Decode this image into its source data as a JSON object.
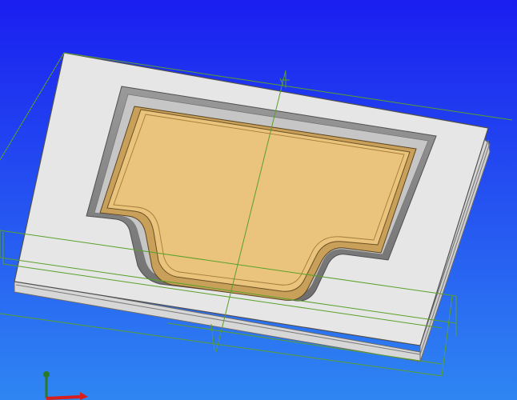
{
  "viewport": {
    "background_top": "#1a1ef0",
    "background_bottom": "#2f86f2"
  },
  "model": {
    "plate_color": "#e6e6e6",
    "plate_edge_color": "#bfbfbf",
    "cavity_wall_color": "#8c8c8c",
    "part_color": "#eac47c",
    "part_rim_color": "#c9a05a",
    "outline_color": "#505050",
    "construction_line_color": "#5aa02a"
  },
  "triad": {
    "icon": "coordinate-triad-icon",
    "x_axis_color": "#d81e1e",
    "y_axis_color": "#2ca02c",
    "z_axis_color": "#2a7a2a"
  }
}
